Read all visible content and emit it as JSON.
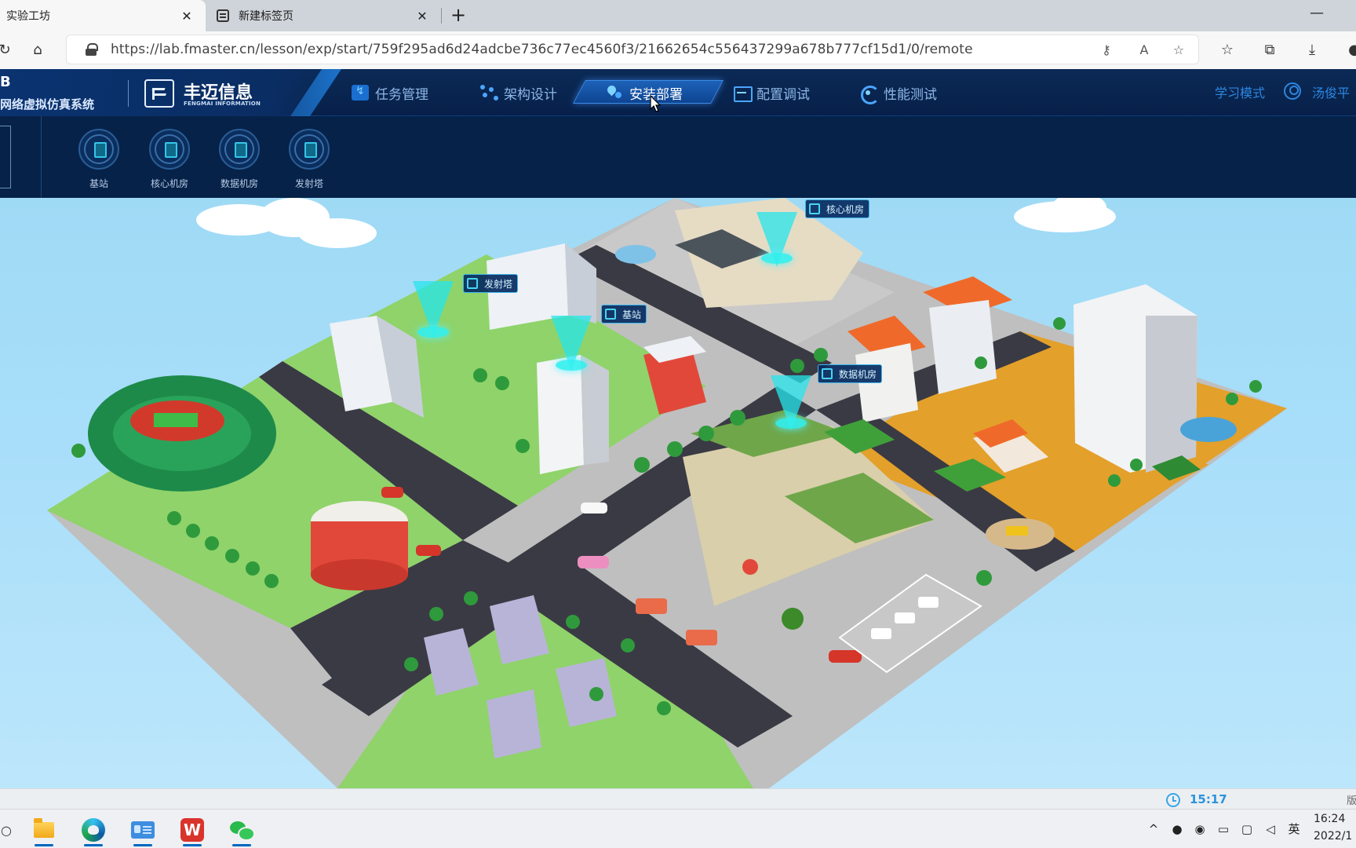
{
  "browser": {
    "tabs": [
      {
        "label": "实验工坊",
        "active": true
      },
      {
        "label": "新建标签页",
        "active": false
      }
    ],
    "url": "https://lab.fmaster.cn/lesson/exp/start/759f295ad6d24adcbe736c77ec4560f3/21662654c556437299a678b777cf15d1/0/remote"
  },
  "app": {
    "system_code": "B",
    "system_name": "网络虚拟仿真系统",
    "brand_name": "丰迈信息",
    "brand_en": "FENGMAI INFORMATION",
    "nav": [
      {
        "label": "任务管理",
        "icon": "task-icon",
        "active": false
      },
      {
        "label": "架构设计",
        "icon": "architecture-icon",
        "active": false
      },
      {
        "label": "安装部署",
        "icon": "deploy-location-icon",
        "active": true
      },
      {
        "label": "配置调试",
        "icon": "config-icon",
        "active": false
      },
      {
        "label": "性能测试",
        "icon": "performance-icon",
        "active": false
      }
    ],
    "mode_label": "学习模式",
    "user_name": "汤俊平",
    "devices": [
      {
        "label": "基站",
        "icon": "base-station-icon"
      },
      {
        "label": "核心机房",
        "icon": "core-room-icon"
      },
      {
        "label": "数据机房",
        "icon": "data-room-icon"
      },
      {
        "label": "发射塔",
        "icon": "tower-icon"
      }
    ],
    "scene_markers": [
      {
        "label": "核心机房"
      },
      {
        "label": "发射塔"
      },
      {
        "label": "基站"
      },
      {
        "label": "数据机房"
      }
    ],
    "timer": "15:17",
    "version": "版"
  },
  "taskbar": {
    "apps": [
      "file-explorer-icon",
      "edge-icon",
      "id-card-app-icon",
      "wps-icon",
      "wechat-icon"
    ],
    "wps_letter": "W",
    "tray_ime": "英",
    "time": "16:24",
    "date": "2022/1"
  },
  "colors": {
    "header_bg": "#07204a",
    "nav_active": "#1d62b8",
    "accent_cyan": "#26e6ec",
    "sky": "#a8defa",
    "grass": "#8fd36a",
    "road": "#3a3a44"
  }
}
